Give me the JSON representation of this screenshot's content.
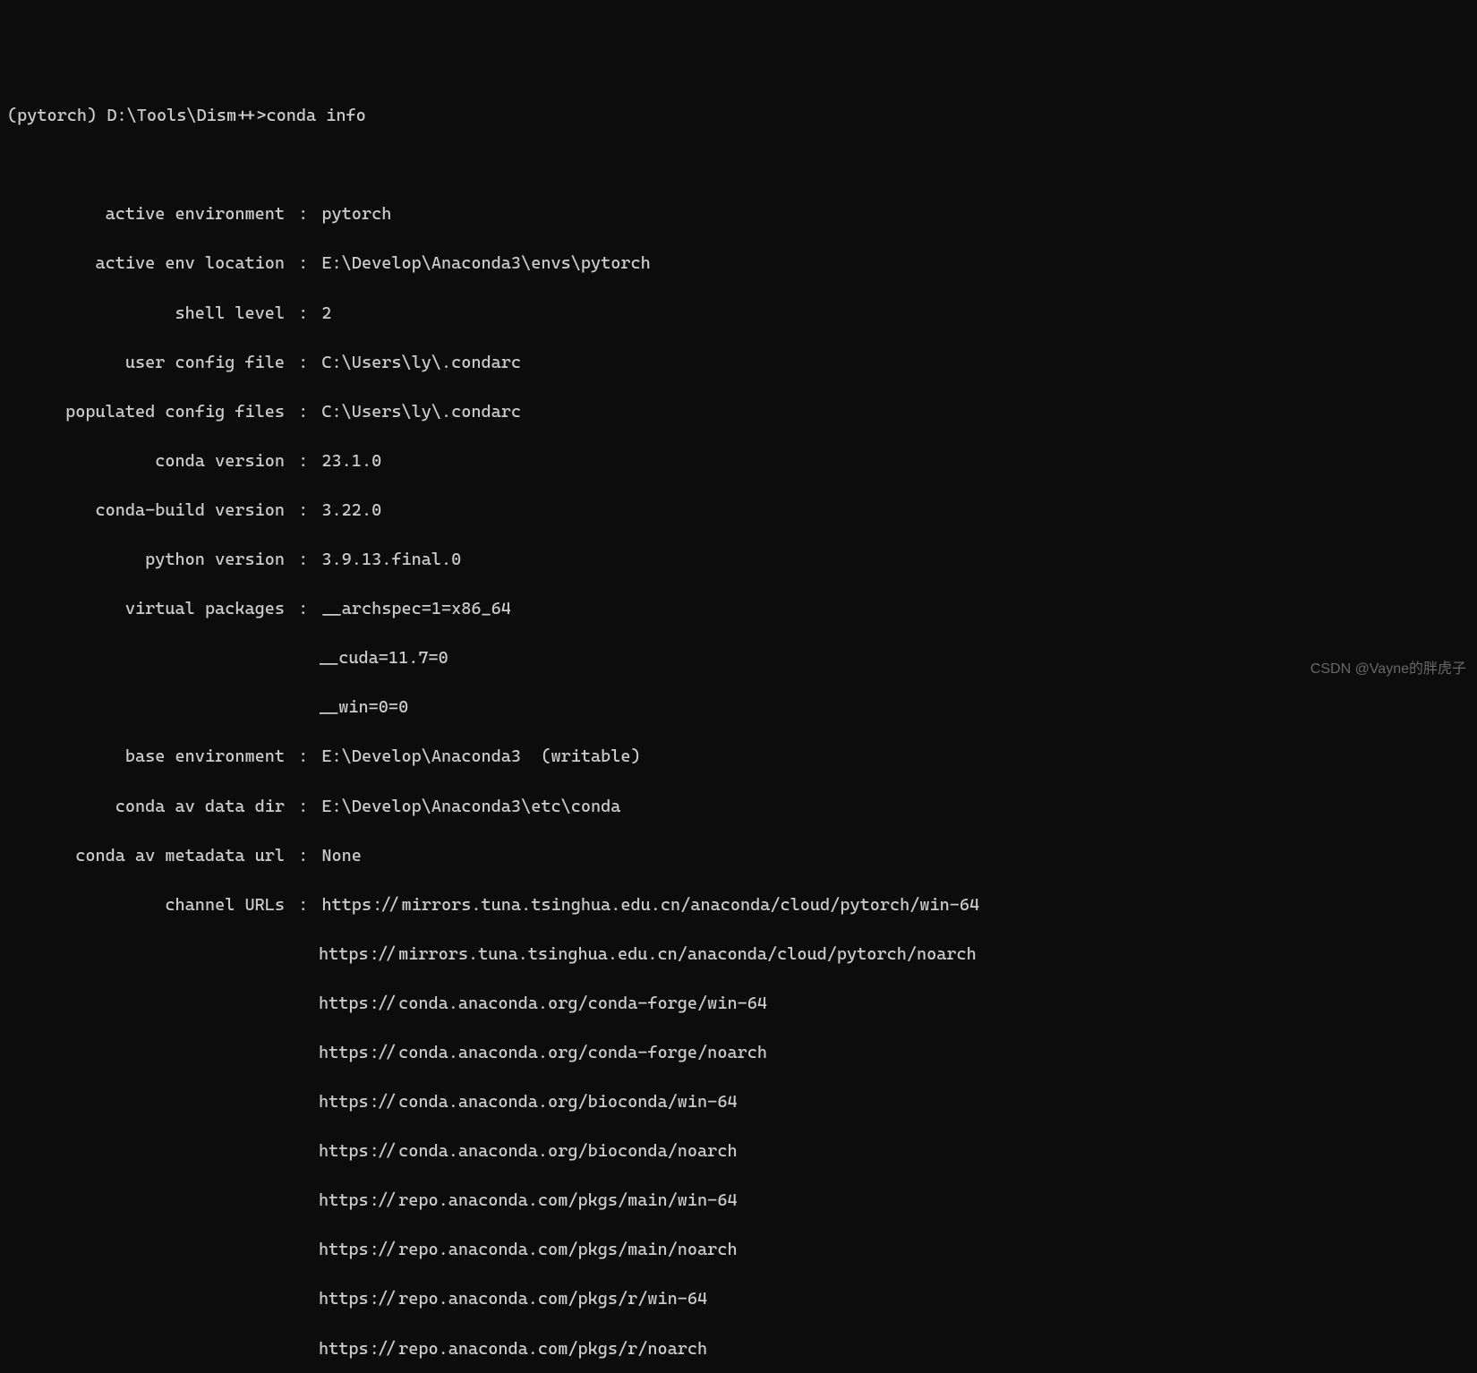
{
  "prompt": {
    "env": "(pytorch)",
    "path": "D:\\Tools\\Dism++>",
    "command": "conda info"
  },
  "info": {
    "active_environment": {
      "label": "active environment",
      "value": "pytorch"
    },
    "active_env_location": {
      "label": "active env location",
      "value": "E:\\Develop\\Anaconda3\\envs\\pytorch"
    },
    "shell_level": {
      "label": "shell level",
      "value": "2"
    },
    "user_config_file": {
      "label": "user config file",
      "value": "C:\\Users\\ly\\.condarc"
    },
    "populated_config_files": {
      "label": "populated config files",
      "value": "C:\\Users\\ly\\.condarc"
    },
    "conda_version": {
      "label": "conda version",
      "value": "23.1.0"
    },
    "conda_build_version": {
      "label": "conda-build version",
      "value": "3.22.0"
    },
    "python_version": {
      "label": "python version",
      "value": "3.9.13.final.0"
    },
    "virtual_packages": {
      "label": "virtual packages",
      "values": [
        "__archspec=1=x86_64",
        "__cuda=11.7=0",
        "__win=0=0"
      ]
    },
    "base_environment": {
      "label": "base environment",
      "value": "E:\\Develop\\Anaconda3  (writable)"
    },
    "conda_av_data_dir": {
      "label": "conda av data dir",
      "value": "E:\\Develop\\Anaconda3\\etc\\conda"
    },
    "conda_av_metadata_url": {
      "label": "conda av metadata url",
      "value": "None"
    },
    "channel_urls": {
      "label": "channel URLs",
      "values": [
        "https://mirrors.tuna.tsinghua.edu.cn/anaconda/cloud/pytorch/win-64",
        "https://mirrors.tuna.tsinghua.edu.cn/anaconda/cloud/pytorch/noarch",
        "https://conda.anaconda.org/conda-forge/win-64",
        "https://conda.anaconda.org/conda-forge/noarch",
        "https://conda.anaconda.org/bioconda/win-64",
        "https://conda.anaconda.org/bioconda/noarch",
        "https://repo.anaconda.com/pkgs/main/win-64",
        "https://repo.anaconda.com/pkgs/main/noarch",
        "https://repo.anaconda.com/pkgs/r/win-64",
        "https://repo.anaconda.com/pkgs/r/noarch"
      ]
    }
  },
  "watermark": "CSDN @Vayne的胖虎子"
}
